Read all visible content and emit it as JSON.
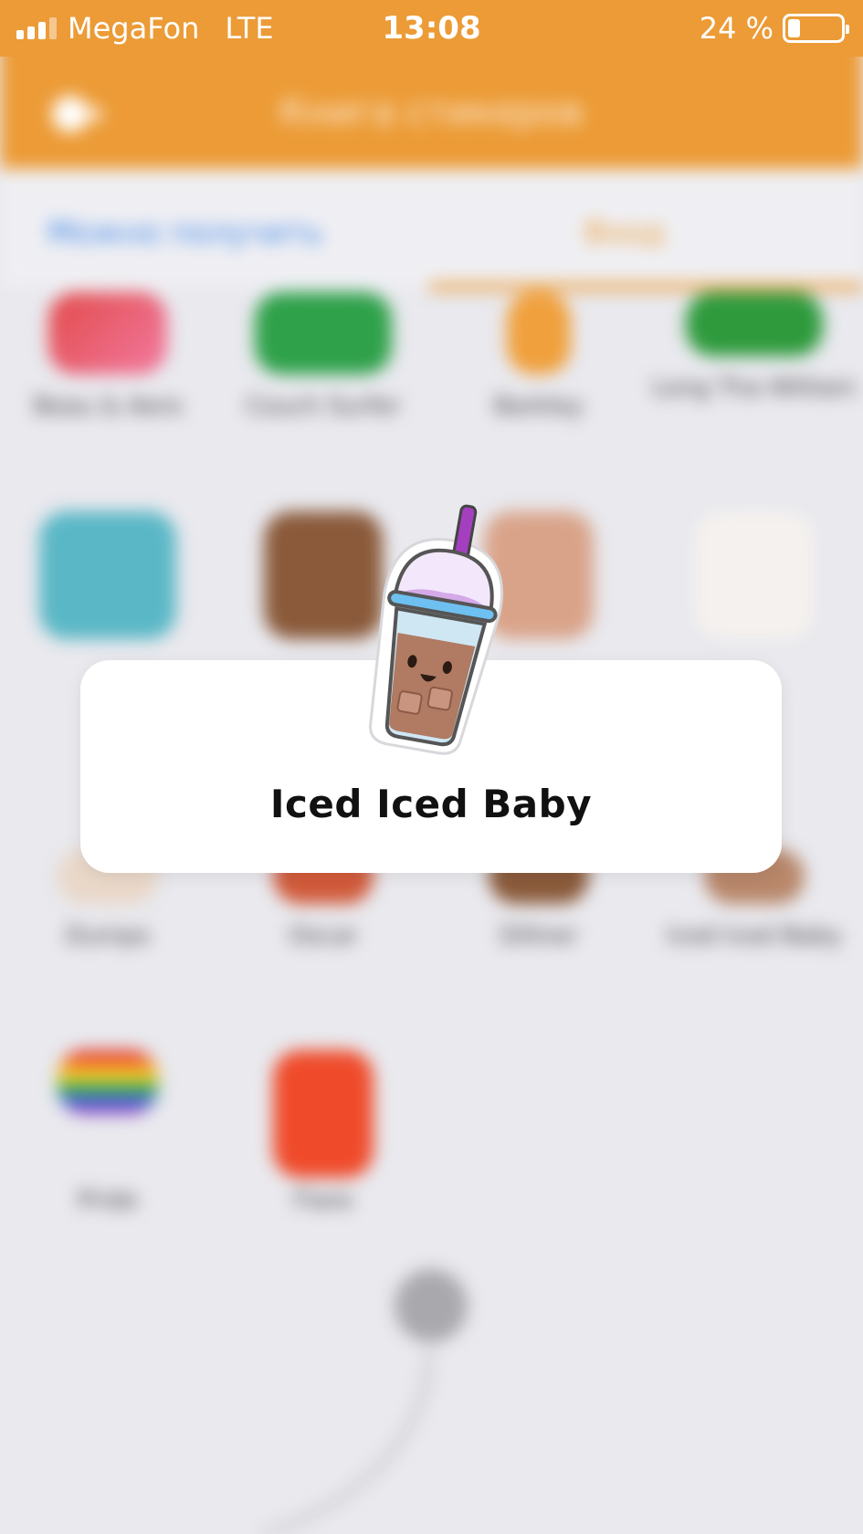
{
  "status_bar": {
    "carrier": "MegaFon",
    "network": "LTE",
    "time": "13:08",
    "battery": "24 %",
    "battery_level": 0.24
  },
  "background": {
    "title": "Книга стикеров",
    "tabs": [
      "Можно получить",
      "Вход"
    ],
    "items": [
      {
        "label": "Beau & Aero"
      },
      {
        "label": "Couch Surfer"
      },
      {
        "label": "Barkley"
      },
      {
        "label": "Long Tha William"
      },
      {
        "label": ""
      },
      {
        "label": ""
      },
      {
        "label": ""
      },
      {
        "label": ""
      },
      {
        "label": "Dumps"
      },
      {
        "label": "Oscar"
      },
      {
        "label": "Dillner"
      },
      {
        "label": "Iced Iced Baby"
      },
      {
        "label": "Pride"
      },
      {
        "label": "Flare"
      }
    ]
  },
  "popup": {
    "title": "Iced Iced Baby",
    "sticker_icon": "iced-coffee-sticker"
  },
  "colors": {
    "accent": "#ec9b36",
    "link": "#3a84e8",
    "background": "#e9e9ee"
  }
}
